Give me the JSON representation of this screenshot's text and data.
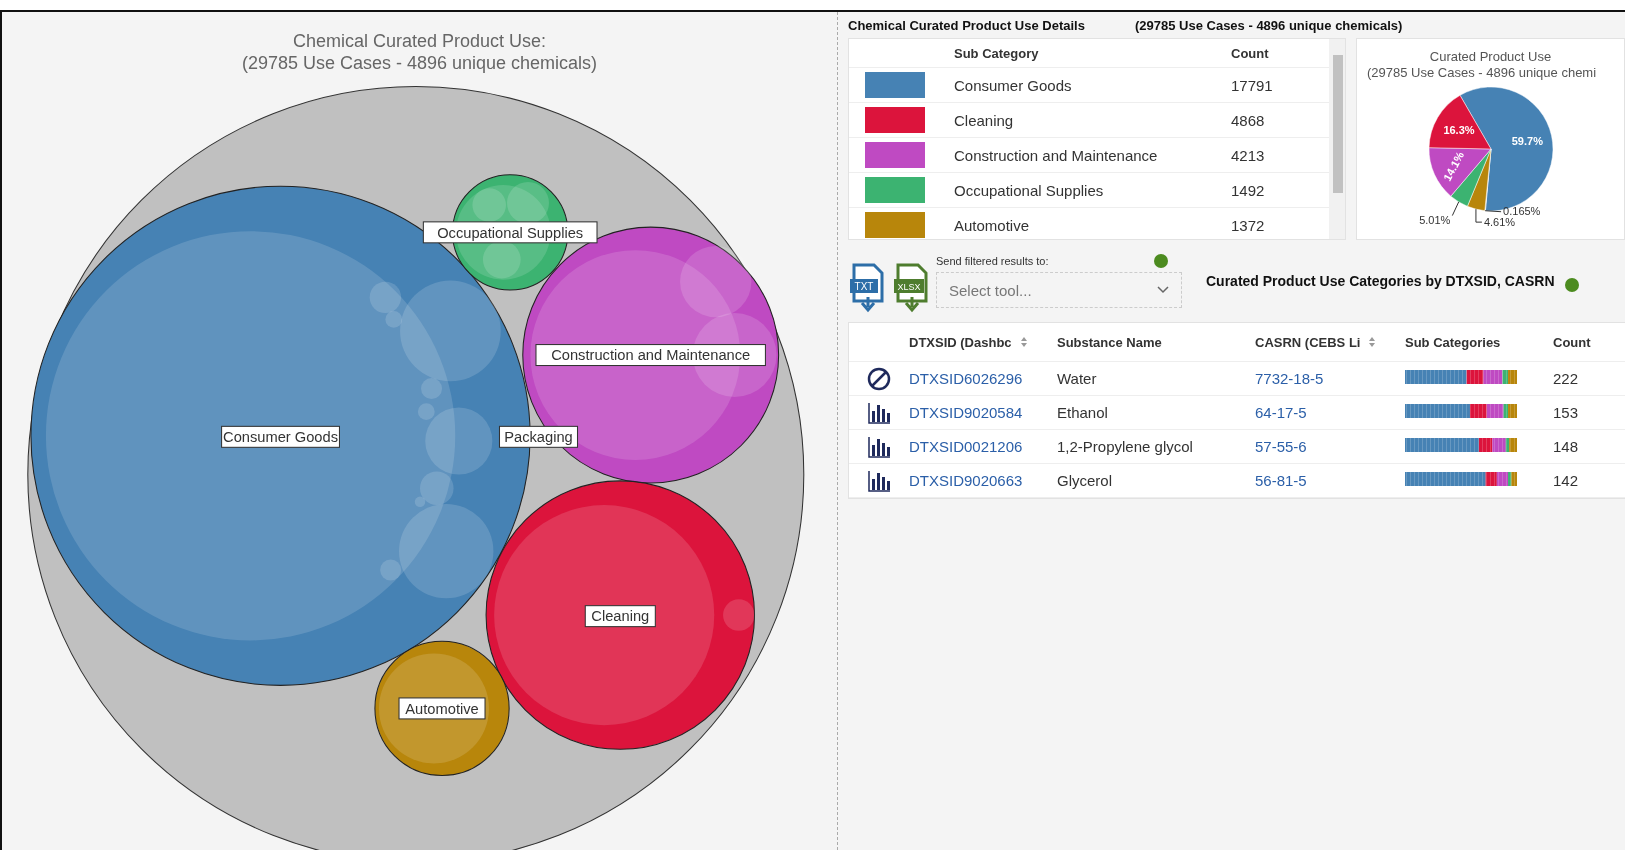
{
  "bubble_chart": {
    "title": "Chemical Curated Product Use:",
    "subtitle": "(29785  Use Cases - 4896 unique chemicals)",
    "bubbles": [
      {
        "label": "Consumer Goods",
        "color": "#4682b4"
      },
      {
        "label": "Occupational Supplies",
        "color": "#3cb371"
      },
      {
        "label": "Construction and Maintenance",
        "color": "#bf4ac2"
      },
      {
        "label": "Packaging"
      },
      {
        "label": "Cleaning",
        "color": "#dc143c"
      },
      {
        "label": "Automotive",
        "color": "#b8860b"
      }
    ]
  },
  "details": {
    "title": "Chemical Curated Product Use Details",
    "summary": "(29785 Use Cases - 4896 unique chemicals)",
    "legend_table": {
      "columns": [
        "Sub Category",
        "Count"
      ],
      "rows": [
        {
          "color": "#4682b4",
          "name": "Consumer Goods",
          "count": "17791"
        },
        {
          "color": "#dc143c",
          "name": "Cleaning",
          "count": "4868"
        },
        {
          "color": "#bf4ac2",
          "name": "Construction and Maintenance",
          "count": "4213"
        },
        {
          "color": "#3cb371",
          "name": "Occupational Supplies",
          "count": "1492"
        },
        {
          "color": "#b8860b",
          "name": "Automotive",
          "count": "1372"
        }
      ]
    },
    "pie": {
      "title": "Curated Product Use",
      "subtitle": "(29785  Use Cases - 4896 unique chemi",
      "chart_data": {
        "type": "pie",
        "values": [
          59.7,
          16.3,
          14.1,
          5.01,
          4.61,
          0.165
        ],
        "colors": [
          "#4682b4",
          "#dc143c",
          "#bf4ac2",
          "#3cb371",
          "#b8860b",
          "#c0c0c0"
        ],
        "value_labels": [
          "59.7%",
          "16.3%",
          "14.1%",
          "5.01%",
          "4.61%",
          "0.165%"
        ]
      }
    }
  },
  "export": {
    "send_label": "Send filtered results to:",
    "select_placeholder": "Select tool...",
    "txt": "TXT",
    "xlsx": "XLSX"
  },
  "substances": {
    "title": "Curated Product Use Categories by DTXSID, CASRN",
    "columns": [
      "DTXSID (Dashbc",
      "Substance Name",
      "CASRN (CEBS Li",
      "Sub Categories",
      "Count"
    ],
    "rows": [
      {
        "kind": "no-data",
        "dtxsid": "DTXSID6026296",
        "name": "Water",
        "casrn": "7732-18-5",
        "count": "222"
      },
      {
        "kind": "bar-chart",
        "dtxsid": "DTXSID9020584",
        "name": "Ethanol",
        "casrn": "64-17-5",
        "count": "153"
      },
      {
        "kind": "bar-chart",
        "dtxsid": "DTXSID0021206",
        "name": "1,2-Propylene glycol",
        "casrn": "57-55-6",
        "count": "148"
      },
      {
        "kind": "bar-chart",
        "dtxsid": "DTXSID9020663",
        "name": "Glycerol",
        "casrn": "56-81-5",
        "count": "142"
      }
    ]
  }
}
